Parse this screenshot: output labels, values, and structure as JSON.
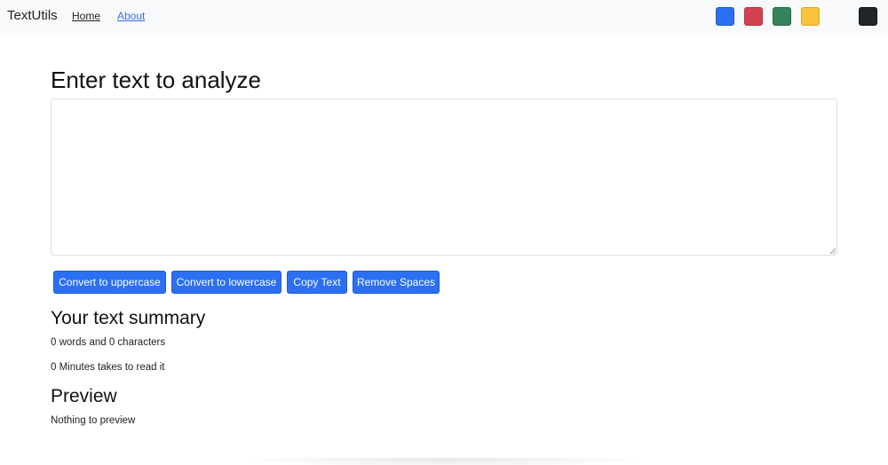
{
  "navbar": {
    "brand": "TextUtils",
    "links": [
      {
        "label": "Home"
      },
      {
        "label": "About"
      }
    ],
    "theme_swatches": [
      {
        "name": "blue",
        "color": "#2b6ff2"
      },
      {
        "name": "red",
        "color": "#d0434f"
      },
      {
        "name": "green",
        "color": "#33845a"
      },
      {
        "name": "yellow",
        "color": "#f7c33b"
      },
      {
        "name": "dark",
        "color": "#22262b"
      }
    ]
  },
  "form": {
    "heading": "Enter text to analyze",
    "textarea_value": "",
    "buttons": {
      "uppercase": "Convert to uppercase",
      "lowercase": "Convert to lowercase",
      "copy": "Copy Text",
      "spaces": "Remove Spaces"
    }
  },
  "summary": {
    "heading": "Your text summary",
    "counts": "0 words and 0 characters",
    "read_time": "0 Minutes takes to read it"
  },
  "preview": {
    "heading": "Preview",
    "text": "Nothing to preview"
  },
  "colors": {
    "accent": "#2b6ff2",
    "navbar_bg": "#f8f9fa"
  }
}
